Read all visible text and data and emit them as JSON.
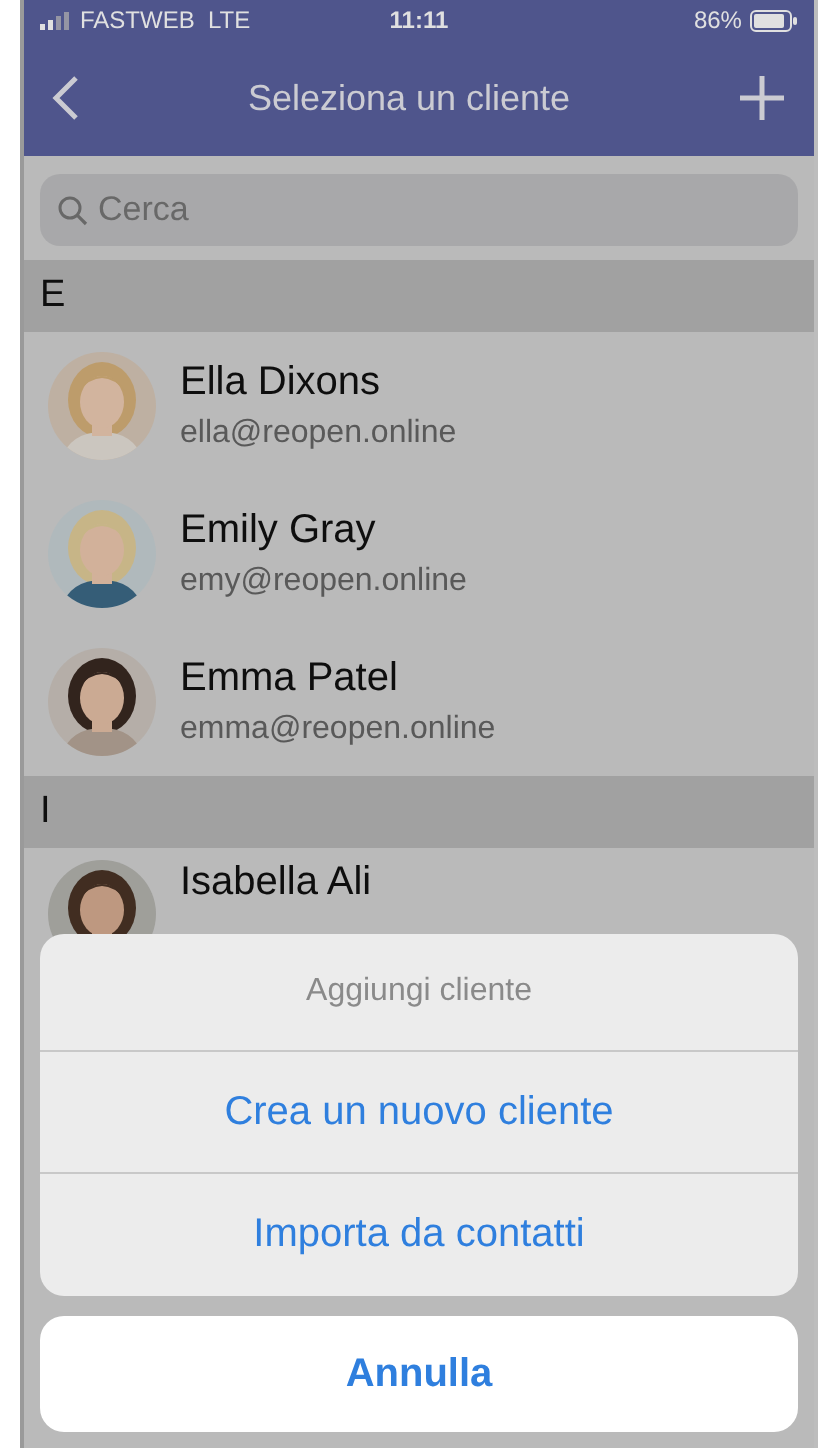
{
  "status_bar": {
    "carrier": "FASTWEB  LTE",
    "time": "11:11",
    "battery": "86%"
  },
  "nav": {
    "title": "Seleziona un cliente"
  },
  "search": {
    "placeholder": "Cerca"
  },
  "sections": [
    {
      "letter": "E",
      "contacts": [
        {
          "name": "Ella Dixons",
          "email": "ella@reopen.online"
        },
        {
          "name": "Emily Gray",
          "email": "emy@reopen.online"
        },
        {
          "name": "Emma Patel",
          "email": "emma@reopen.online"
        }
      ]
    },
    {
      "letter": "I",
      "contacts": [
        {
          "name": "Isabella Ali"
        }
      ]
    }
  ],
  "action_sheet": {
    "title": "Aggiungi cliente",
    "actions": [
      "Crea un nuovo cliente",
      "Importa da contatti"
    ],
    "cancel": "Annulla"
  }
}
